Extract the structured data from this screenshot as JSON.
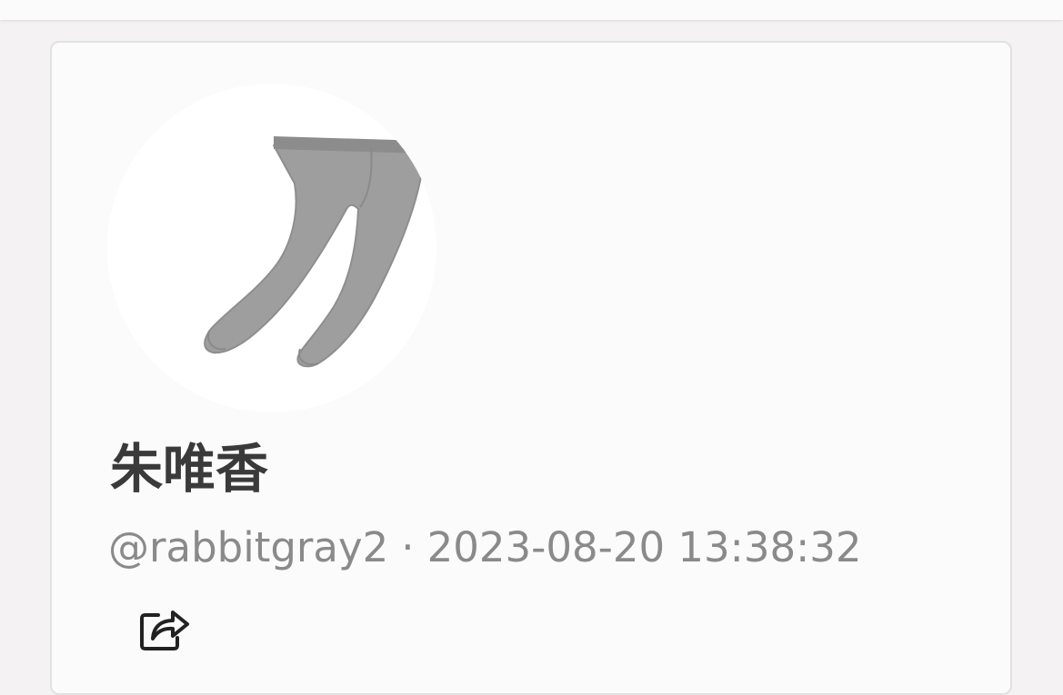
{
  "post": {
    "author_name": "朱唯香",
    "handle": "@rabbitgray2",
    "separator": "·",
    "timestamp": "2023-08-20 13:38:32"
  },
  "avatar": {
    "icon": "tights-icon",
    "color": "#9e9e9e"
  },
  "actions": {
    "share_icon": "share-icon"
  }
}
